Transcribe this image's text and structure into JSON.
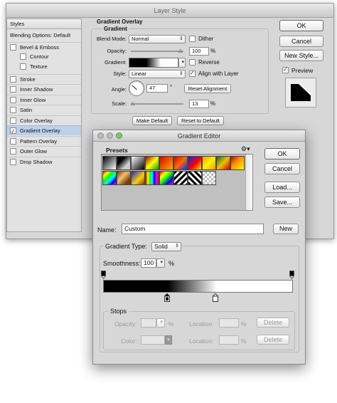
{
  "layer_style": {
    "title": "Layer Style",
    "sidebar": {
      "header": "Styles",
      "items": [
        {
          "label": "Blending Options: Default",
          "checkbox": false,
          "checked": false
        },
        {
          "label": "Bevel & Emboss",
          "checkbox": true,
          "checked": false
        },
        {
          "label": "Contour",
          "checkbox": true,
          "checked": false
        },
        {
          "label": "Texture",
          "checkbox": true,
          "checked": false
        },
        {
          "label": "Stroke",
          "checkbox": true,
          "checked": false
        },
        {
          "label": "Inner Shadow",
          "checkbox": true,
          "checked": false
        },
        {
          "label": "Inner Glow",
          "checkbox": true,
          "checked": false
        },
        {
          "label": "Satin",
          "checkbox": true,
          "checked": false
        },
        {
          "label": "Color Overlay",
          "checkbox": true,
          "checked": false
        },
        {
          "label": "Gradient Overlay",
          "checkbox": true,
          "checked": true
        },
        {
          "label": "Pattern Overlay",
          "checkbox": true,
          "checked": false
        },
        {
          "label": "Outer Glow",
          "checkbox": true,
          "checked": false
        },
        {
          "label": "Drop Shadow",
          "checkbox": true,
          "checked": false
        }
      ]
    },
    "panel": {
      "section_title": "Gradient Overlay",
      "group_title": "Gradient",
      "blend_mode_label": "Blend Mode:",
      "blend_mode_value": "Normal",
      "dither_label": "Dither",
      "opacity_label": "Opacity:",
      "opacity_value": "100",
      "opacity_unit": "%",
      "gradient_label": "Gradient:",
      "reverse_label": "Reverse",
      "style_label": "Style:",
      "style_value": "Linear",
      "align_label": "Align with Layer",
      "angle_label": "Angle:",
      "angle_value": "47",
      "angle_unit": "°",
      "reset_alignment_label": "Reset Alignment",
      "scale_label": "Scale:",
      "scale_value": "13",
      "scale_unit": "%",
      "make_default_label": "Make Default",
      "reset_default_label": "Reset to Default"
    },
    "buttons": {
      "ok": "OK",
      "cancel": "Cancel",
      "new_style": "New Style...",
      "preview": "Preview"
    }
  },
  "gradient_editor": {
    "title": "Gradient Editor",
    "presets_label": "Presets",
    "gear_icon": "gear-icon",
    "buttons": {
      "ok": "OK",
      "cancel": "Cancel",
      "load": "Load...",
      "save": "Save...",
      "new": "New",
      "delete_1": "Delete",
      "delete_2": "Delete"
    },
    "name_label": "Name:",
    "name_value": "Custom",
    "gradient_type_label": "Gradient Type:",
    "gradient_type_value": "Solid",
    "smoothness_label": "Smoothness:",
    "smoothness_value": "100",
    "smoothness_unit": "%",
    "stops": {
      "title": "Stops",
      "opacity_label": "Opacity:",
      "opacity_unit": "%",
      "location_label": "Location:",
      "location_unit": "%",
      "color_label": "Color:",
      "location2_label": "Location:",
      "location2_unit": "%"
    }
  }
}
